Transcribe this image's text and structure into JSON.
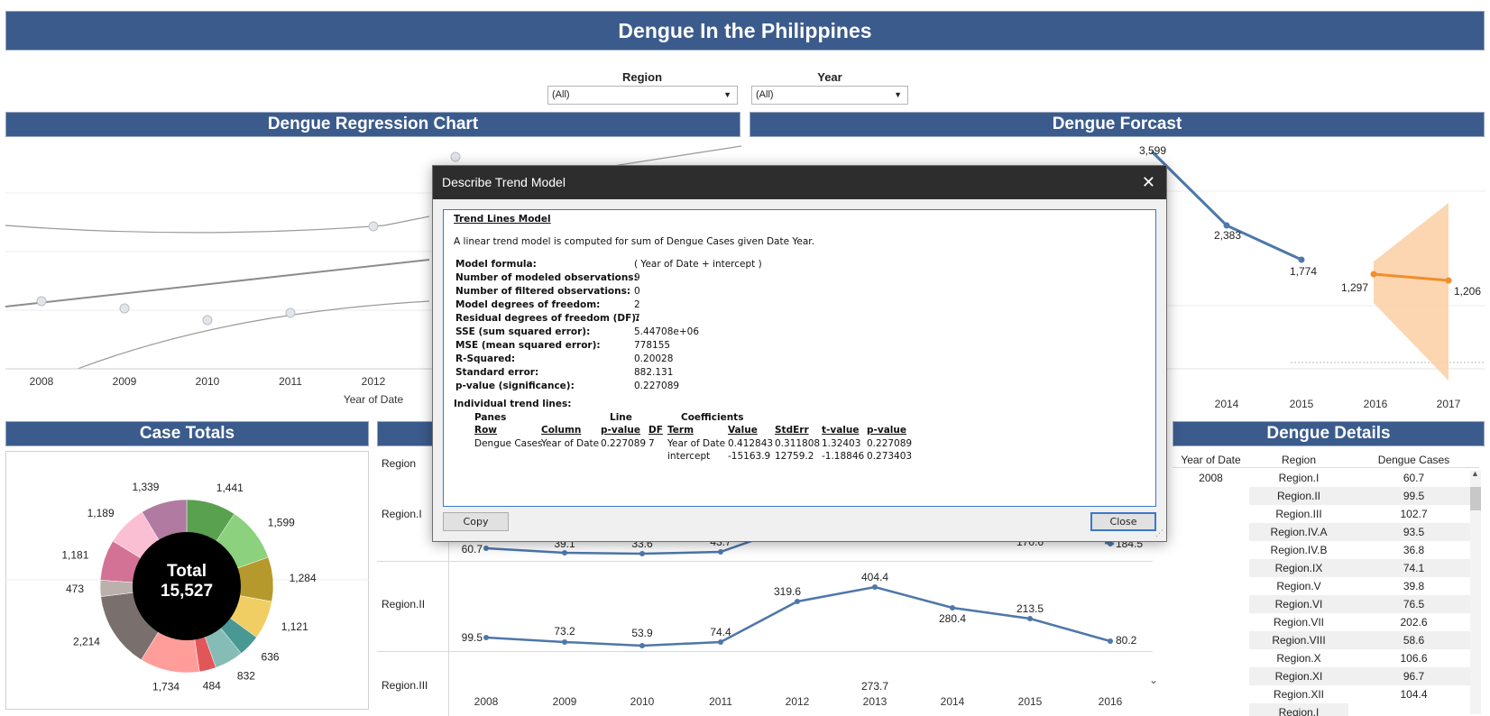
{
  "page": {
    "title": "Dengue In the Philippines"
  },
  "filters": {
    "region": {
      "label": "Region",
      "value": "(All)"
    },
    "year": {
      "label": "Year",
      "value": "(All)"
    }
  },
  "regression_panel": {
    "title": "Dengue Regression Chart",
    "x_ticks": [
      "2008",
      "2009",
      "2010",
      "2011",
      "2012"
    ],
    "xlabel": "Year of Date"
  },
  "forecast_panel": {
    "title": "Dengue Forcast",
    "x_ticks": [
      "2014",
      "2015",
      "2016",
      "2017"
    ],
    "labels": [
      "3,599",
      "2,383",
      "1,774",
      "1,297",
      "1,206"
    ]
  },
  "case_totals": {
    "title": "Case Totals",
    "center_label": "Total",
    "center_value": "15,527",
    "slice_labels": [
      "1,441",
      "1,599",
      "1,284",
      "1,121",
      "636",
      "832",
      "484",
      "1,734",
      "2,214",
      "473",
      "1,181",
      "1,189",
      "1,339"
    ]
  },
  "region_panel": {
    "row_header": "Region",
    "rows": [
      "Region.I",
      "Region.II",
      "Region.III"
    ],
    "x_ticks": [
      "2008",
      "2009",
      "2010",
      "2011",
      "2012",
      "2013",
      "2014",
      "2015",
      "2016"
    ],
    "r1_labels": [
      "60.7",
      "39.1",
      "33.6",
      "43.7",
      "170.6",
      "184.5"
    ],
    "r2_labels": [
      "99.5",
      "73.2",
      "53.9",
      "74.4",
      "319.6",
      "404.4",
      "280.4",
      "213.5",
      "80.2"
    ],
    "r3_labels": [
      "273.7"
    ]
  },
  "details": {
    "title": "Dengue Details",
    "headers": [
      "Year of Date",
      "Region",
      "Dengue Cases"
    ],
    "year": "2008",
    "rows": [
      {
        "region": "Region.I",
        "value": "60.7"
      },
      {
        "region": "Region.II",
        "value": "99.5"
      },
      {
        "region": "Region.III",
        "value": "102.7"
      },
      {
        "region": "Region.IV.A",
        "value": "93.5"
      },
      {
        "region": "Region.IV.B",
        "value": "36.8"
      },
      {
        "region": "Region.IX",
        "value": "74.1"
      },
      {
        "region": "Region.V",
        "value": "39.8"
      },
      {
        "region": "Region.VI",
        "value": "76.5"
      },
      {
        "region": "Region.VII",
        "value": "202.6"
      },
      {
        "region": "Region.VIII",
        "value": "58.6"
      },
      {
        "region": "Region.X",
        "value": "106.6"
      },
      {
        "region": "Region.XI",
        "value": "96.7"
      },
      {
        "region": "Region.XII",
        "value": "104.4"
      },
      {
        "region": "Region.I",
        "value": ""
      }
    ]
  },
  "dialog": {
    "title": "Describe Trend Model",
    "heading": "Trend Lines Model",
    "description": "A linear trend model is computed for sum of Dengue Cases given Date Year.",
    "stats": [
      {
        "label": "Model formula:",
        "value": "( Year of Date + intercept )"
      },
      {
        "label": "Number of modeled observations:",
        "value": "9"
      },
      {
        "label": "Number of filtered observations:",
        "value": "0"
      },
      {
        "label": "Model degrees of freedom:",
        "value": "2"
      },
      {
        "label": "Residual degrees of freedom (DF):",
        "value": "7"
      },
      {
        "label": "SSE (sum squared error):",
        "value": "5.44708e+06"
      },
      {
        "label": "MSE (mean squared error):",
        "value": "778155"
      },
      {
        "label": "R-Squared:",
        "value": "0.20028"
      },
      {
        "label": "Standard error:",
        "value": "882.131"
      },
      {
        "label": "p-value (significance):",
        "value": "0.227089"
      }
    ],
    "individual_heading": "Individual trend lines:",
    "group_headers": {
      "panes": "Panes",
      "line": "Line",
      "coefficients": "Coefficients"
    },
    "col_headers": [
      "Row",
      "Column",
      "p-value",
      "DF",
      "Term",
      "Value",
      "StdErr",
      "t-value",
      "p-value"
    ],
    "row1": [
      "Dengue Cases",
      "Year of Date",
      "0.227089",
      "7",
      "Year of Date",
      "0.412843",
      "0.311808",
      "1.32403",
      "0.227089"
    ],
    "row2": [
      "intercept",
      "-15163.9",
      "12759.2",
      "-1.18846",
      "0.273403"
    ],
    "copy_label": "Copy",
    "close_label": "Close",
    "close_icon": "✕"
  },
  "colors": {
    "header_blue": "#3b5b8c",
    "line_blue": "#4e77aa",
    "forecast_orange": "#f28e2b",
    "forecast_band": "#fbd2a8"
  }
}
